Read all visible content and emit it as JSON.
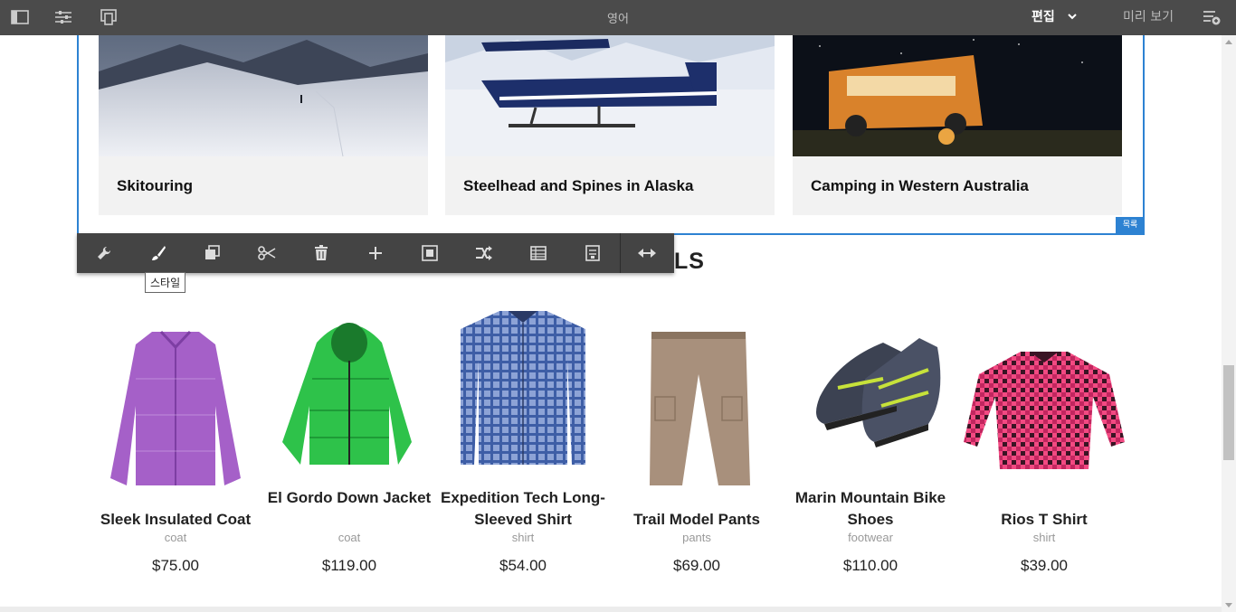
{
  "topbar": {
    "title": "영어",
    "mode_label": "편집",
    "preview_label": "미리 보기"
  },
  "list_component": {
    "badge": "목록",
    "items": [
      {
        "caption": "Skitouring"
      },
      {
        "caption": "Steelhead and Spines in Alaska"
      },
      {
        "caption": "Camping in Western Australia"
      }
    ]
  },
  "section_heading_partial": "LS",
  "toolbar": {
    "buttons": [
      "configure",
      "style",
      "copy",
      "cut",
      "delete",
      "insert",
      "parent",
      "move",
      "layout",
      "group",
      "resize"
    ],
    "tooltip": "스타일"
  },
  "products": [
    {
      "name": "Sleek Insulated Coat",
      "type": "coat",
      "price": "$75.00"
    },
    {
      "name": "El Gordo Down Jacket",
      "type": "coat",
      "price": "$119.00"
    },
    {
      "name": "Expedition Tech Long-Sleeved Shirt",
      "type": "shirt",
      "price": "$54.00"
    },
    {
      "name": "Trail Model Pants",
      "type": "pants",
      "price": "$69.00"
    },
    {
      "name": "Marin Mountain Bike Shoes",
      "type": "footwear",
      "price": "$110.00"
    },
    {
      "name": "Rios T Shirt",
      "type": "shirt",
      "price": "$39.00"
    }
  ],
  "colors": {
    "topbar": "#4b4b4b",
    "selection": "#2d82d2",
    "toolbar": "#444444"
  }
}
